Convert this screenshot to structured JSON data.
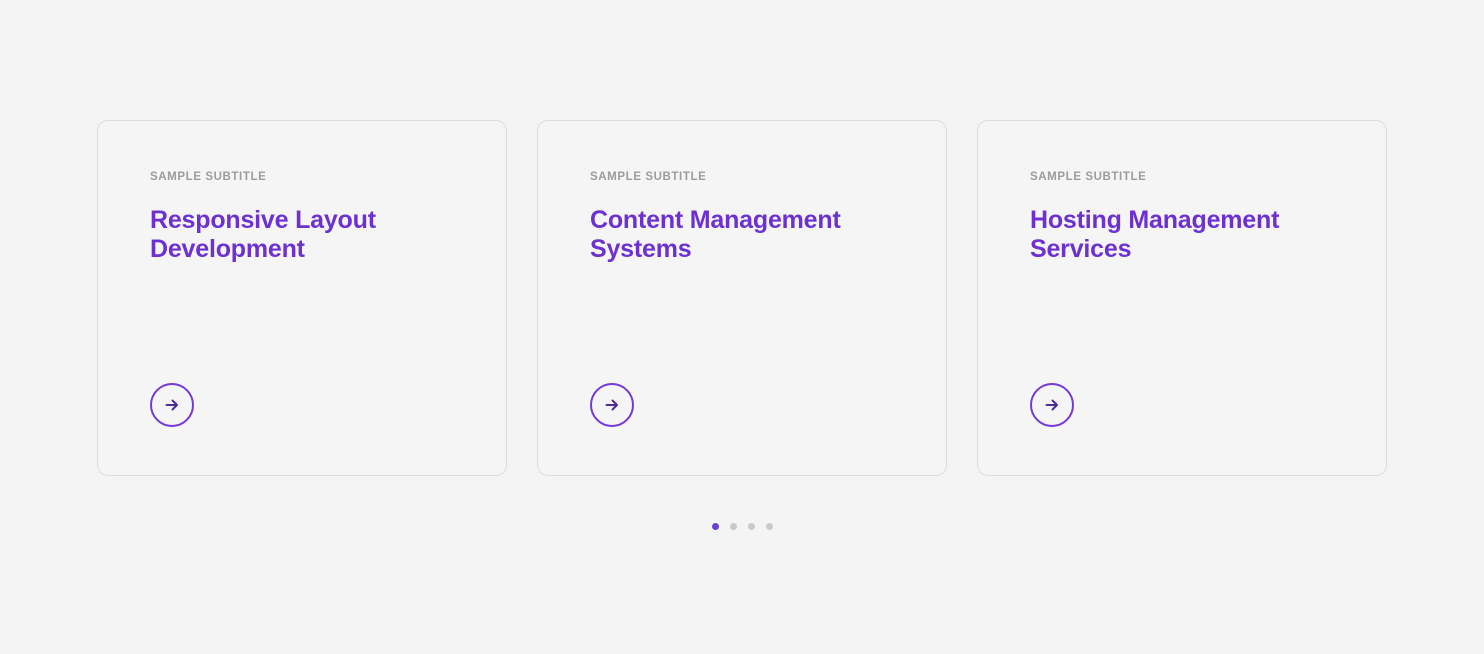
{
  "cards": [
    {
      "subtitle": "SAMPLE SUBTITLE",
      "title": "Responsive Layout Development"
    },
    {
      "subtitle": "SAMPLE SUBTITLE",
      "title": "Content Management Systems"
    },
    {
      "subtitle": "SAMPLE SUBTITLE",
      "title": "Hosting Management Services"
    }
  ],
  "carousel": {
    "dot_count": 4,
    "active_index": 0
  },
  "icons": {
    "card_action": "arrow-right-icon"
  },
  "colors": {
    "page_bg": "#f5f4f5",
    "card_bg": "#f6f5f6",
    "card_border": "#dcdbdc",
    "title": "#6d31d1",
    "subtitle": "#9c9b9d",
    "circle_border": "#7439d8",
    "arrow": "#4f2a99",
    "dot_active": "#6b3fd6",
    "dot_inactive": "#c9c8ca"
  }
}
